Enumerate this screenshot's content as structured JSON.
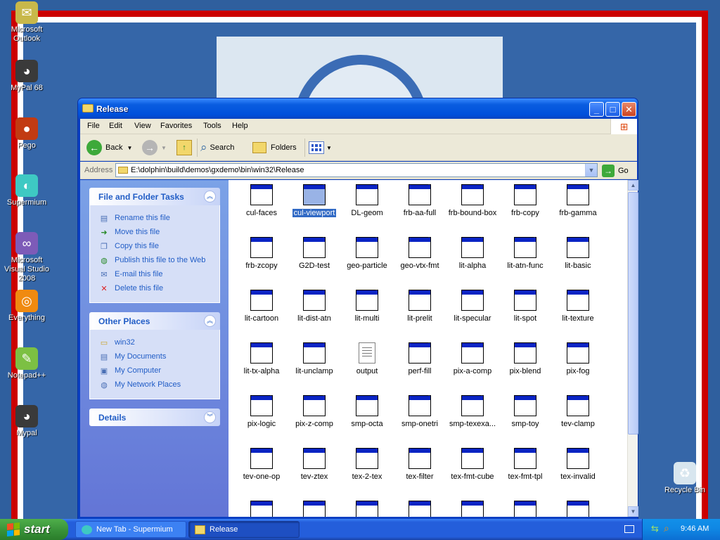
{
  "desktop": {
    "icons": [
      {
        "label": "Microsoft Outlook",
        "icon": "outlook-icon",
        "color": "#c8b84a"
      },
      {
        "label": "MyPal 68",
        "icon": "raccoon-icon",
        "color": "#3a3a3a"
      },
      {
        "label": "Pego",
        "icon": "pego-icon",
        "color": "#c23b12"
      },
      {
        "label": "Supermium",
        "icon": "supermium-icon",
        "color": "#3ec9c3"
      },
      {
        "label": "Microsoft Visual Studio 2008",
        "icon": "visual-studio-icon",
        "color": "#7d5bb8"
      },
      {
        "label": "Everything",
        "icon": "everything-icon",
        "color": "#f08a10"
      },
      {
        "label": "Notepad++",
        "icon": "notepad-plus-plus-icon",
        "color": "#7cc043"
      },
      {
        "label": "Mypal",
        "icon": "raccoon-icon",
        "color": "#3a3a3a"
      },
      {
        "label": "Recycle Bin",
        "icon": "recycle-bin-icon",
        "color": "#d8e6ef"
      }
    ]
  },
  "window": {
    "title": "Release",
    "controls": {
      "minimize": "_",
      "maximize": "□",
      "close": "✕"
    },
    "menu": [
      "File",
      "Edit",
      "View",
      "Favorites",
      "Tools",
      "Help"
    ],
    "toolbar": {
      "back": "Back",
      "search": "Search",
      "folders": "Folders"
    },
    "address": {
      "label": "Address",
      "path": "E:\\dolphin\\build\\demos\\gxdemo\\bin\\win32\\Release",
      "go": "Go"
    }
  },
  "taskpane": {
    "file_tasks": {
      "title": "File and Folder Tasks",
      "items": [
        {
          "label": "Rename this file",
          "icon": "rename-icon"
        },
        {
          "label": "Move this file",
          "icon": "move-icon"
        },
        {
          "label": "Copy this file",
          "icon": "copy-icon"
        },
        {
          "label": "Publish this file to the Web",
          "icon": "globe-icon"
        },
        {
          "label": "E-mail this file",
          "icon": "email-icon"
        },
        {
          "label": "Delete this file",
          "icon": "delete-icon"
        }
      ]
    },
    "other_places": {
      "title": "Other Places",
      "items": [
        {
          "label": "win32",
          "icon": "folder-icon"
        },
        {
          "label": "My Documents",
          "icon": "my-documents-icon"
        },
        {
          "label": "My Computer",
          "icon": "my-computer-icon"
        },
        {
          "label": "My Network Places",
          "icon": "network-icon"
        }
      ]
    },
    "details": {
      "title": "Details"
    }
  },
  "files": [
    "cul-faces",
    "cul-viewport",
    "DL-geom",
    "frb-aa-full",
    "frb-bound-box",
    "frb-copy",
    "frb-gamma",
    "frb-zcopy",
    "G2D-test",
    "geo-particle",
    "geo-vtx-fmt",
    "lit-alpha",
    "lit-atn-func",
    "lit-basic",
    "lit-cartoon",
    "lit-dist-atn",
    "lit-multi",
    "lit-prelit",
    "lit-specular",
    "lit-spot",
    "lit-texture",
    "lit-tx-alpha",
    "lit-unclamp",
    "output",
    "perf-fill",
    "pix-a-comp",
    "pix-blend",
    "pix-fog",
    "pix-logic",
    "pix-z-comp",
    "smp-octa",
    "smp-onetri",
    "smp-texexa...",
    "smp-toy",
    "tev-clamp",
    "tev-one-op",
    "tev-ztex",
    "tex-2-tex",
    "tex-filter",
    "tex-fmt-cube",
    "tex-fmt-tpl",
    "tex-invalid"
  ],
  "selected_file": "cul-viewport",
  "text_files": [
    "output"
  ],
  "taskbar": {
    "start": "start",
    "tasks": [
      {
        "label": "New Tab - Supermium",
        "icon": "supermium-icon"
      },
      {
        "label": "Release",
        "icon": "folder-icon"
      }
    ],
    "clock": "9:46 AM"
  },
  "colors": {
    "xp_blue": "#0a5de0",
    "selection": "#316ac5",
    "task_link": "#215dc6",
    "frame_red": "#cc0000"
  }
}
